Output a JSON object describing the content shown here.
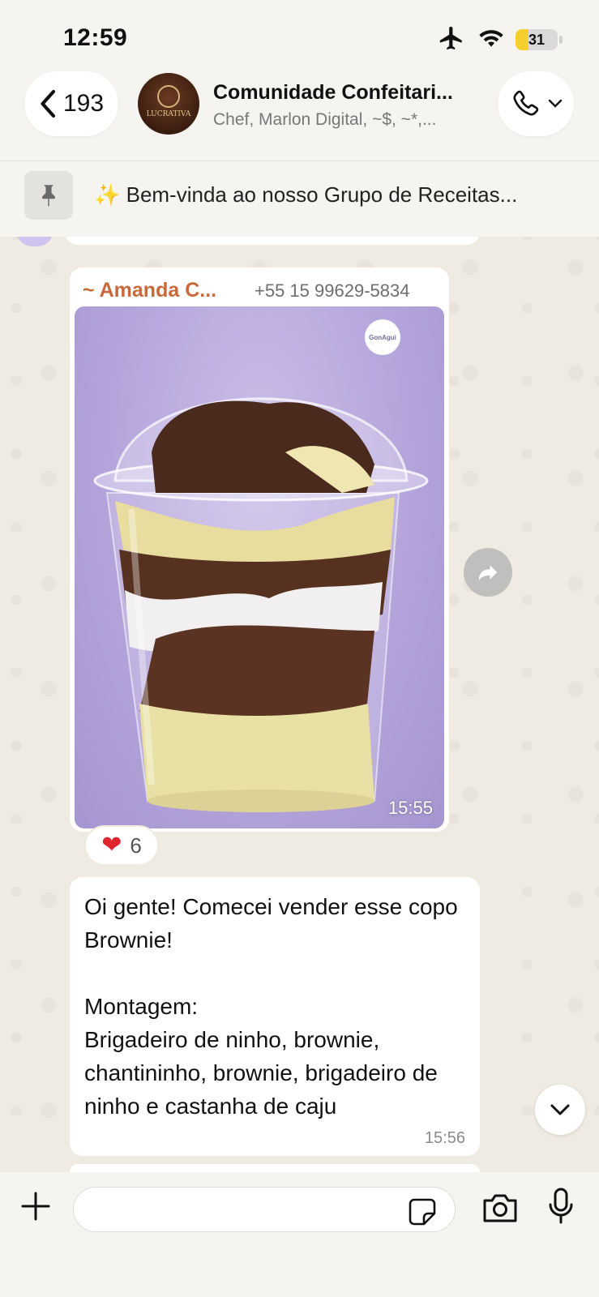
{
  "status_bar": {
    "time": "12:59",
    "battery": "31",
    "battery_level": 0.31
  },
  "header": {
    "back_count": "193",
    "title": "Comunidade Confeitari...",
    "subtitle": "Chef, Marlon Digital, ~$, ~*,...",
    "avatar_text": "LUCRATIVA"
  },
  "pinned": {
    "text": "✨ Bem-vinda ao nosso Grupo de Receitas..."
  },
  "messages": {
    "image_message": {
      "sender_name": "~ Amanda C...",
      "sender_phone": "+55 15 99629-5834",
      "photo_logo": "GonAgui",
      "time": "15:55",
      "reaction_emoji": "❤️",
      "reaction_count": "6"
    },
    "text_message": {
      "text": "Oi gente! Comecei vender esse copo Brownie!\n\nMontagem:\nBrigadeiro de ninho, brownie, chantininho, brownie, brigadeiro de ninho e castanha de caju",
      "time": "15:56"
    }
  },
  "composer": {
    "placeholder": ""
  },
  "colors": {
    "sender": "#c8693c",
    "background": "#efeae2",
    "bubble": "#ffffff"
  }
}
